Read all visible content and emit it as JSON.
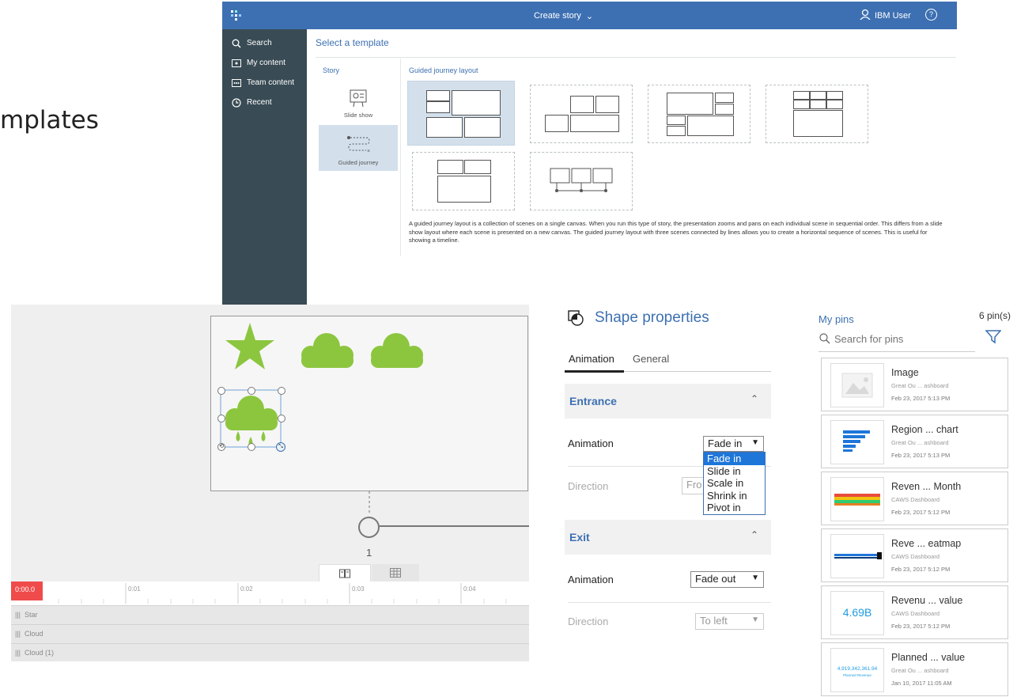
{
  "slide": {
    "title_fragment": "mplates"
  },
  "top_app": {
    "title": "Create story",
    "user": "IBM User",
    "sidebar": [
      {
        "label": "Search",
        "icon": "search-icon"
      },
      {
        "label": "My content",
        "icon": "folder-user-icon"
      },
      {
        "label": "Team content",
        "icon": "folder-team-icon"
      },
      {
        "label": "Recent",
        "icon": "clock-icon"
      }
    ],
    "heading": "Select a template",
    "story_label": "Story",
    "guided_label": "Guided journey layout",
    "story_types": [
      {
        "label": "Slide show"
      },
      {
        "label": "Guided journey"
      }
    ],
    "description": "A guided journey layout is a collection of scenes on a single canvas. When you run this type of story, the presentation zooms and pans on each individual scene in sequential order. This differs from a slide show layout where each scene is presented on a new canvas. The guided journey layout with three scenes connected by lines allows you to create a horizontal sequence of scenes. This is useful for showing a timeline."
  },
  "canvas": {
    "scene_number": "1",
    "time_marker": "0:00.0",
    "ticks": [
      "0:01",
      "0:02",
      "0:03",
      "0:04"
    ],
    "tracks": [
      "Star",
      "Cloud",
      "Cloud (1)"
    ],
    "shape_color": "#8cc63f"
  },
  "props": {
    "title": "Shape properties",
    "tabs": [
      "Animation",
      "General"
    ],
    "entrance": {
      "title": "Entrance",
      "animation_label": "Animation",
      "animation_value": "Fade in",
      "direction_label": "Direction",
      "direction_value": "Fro",
      "options": [
        "Fade in",
        "Slide in",
        "Scale in",
        "Shrink in",
        "Pivot in"
      ]
    },
    "exit": {
      "title": "Exit",
      "animation_label": "Animation",
      "animation_value": "Fade out",
      "direction_label": "Direction",
      "direction_value": "To left"
    }
  },
  "pins": {
    "title": "My pins",
    "count": "6 pin(s)",
    "search_placeholder": "Search for pins",
    "items": [
      {
        "title": "Image",
        "source": "Great Ou ... ashboard",
        "date": "Feb 23, 2017 5:13 PM"
      },
      {
        "title": "Region ... chart",
        "source": "Great Ou ... ashboard",
        "date": "Feb 23, 2017 5:13 PM"
      },
      {
        "title": "Reven ... Month",
        "source": "CAWS Dashboard",
        "date": "Feb 23, 2017 5:12 PM"
      },
      {
        "title": "Reve ... eatmap",
        "source": "CAWS Dashboard",
        "date": "Feb 23, 2017 5:12 PM"
      },
      {
        "title": "Revenu ... value",
        "source": "CAWS Dashboard",
        "date": "Feb 23, 2017 5:12 PM",
        "thumb_value": "4.69B"
      },
      {
        "title": "Planned ... value",
        "source": "Great Ou ... ashboard",
        "date": "Jan 10, 2017 11:05 AM",
        "thumb_value": "4,919,342,361.94",
        "thumb_caption": "Planned Revenue"
      }
    ]
  }
}
